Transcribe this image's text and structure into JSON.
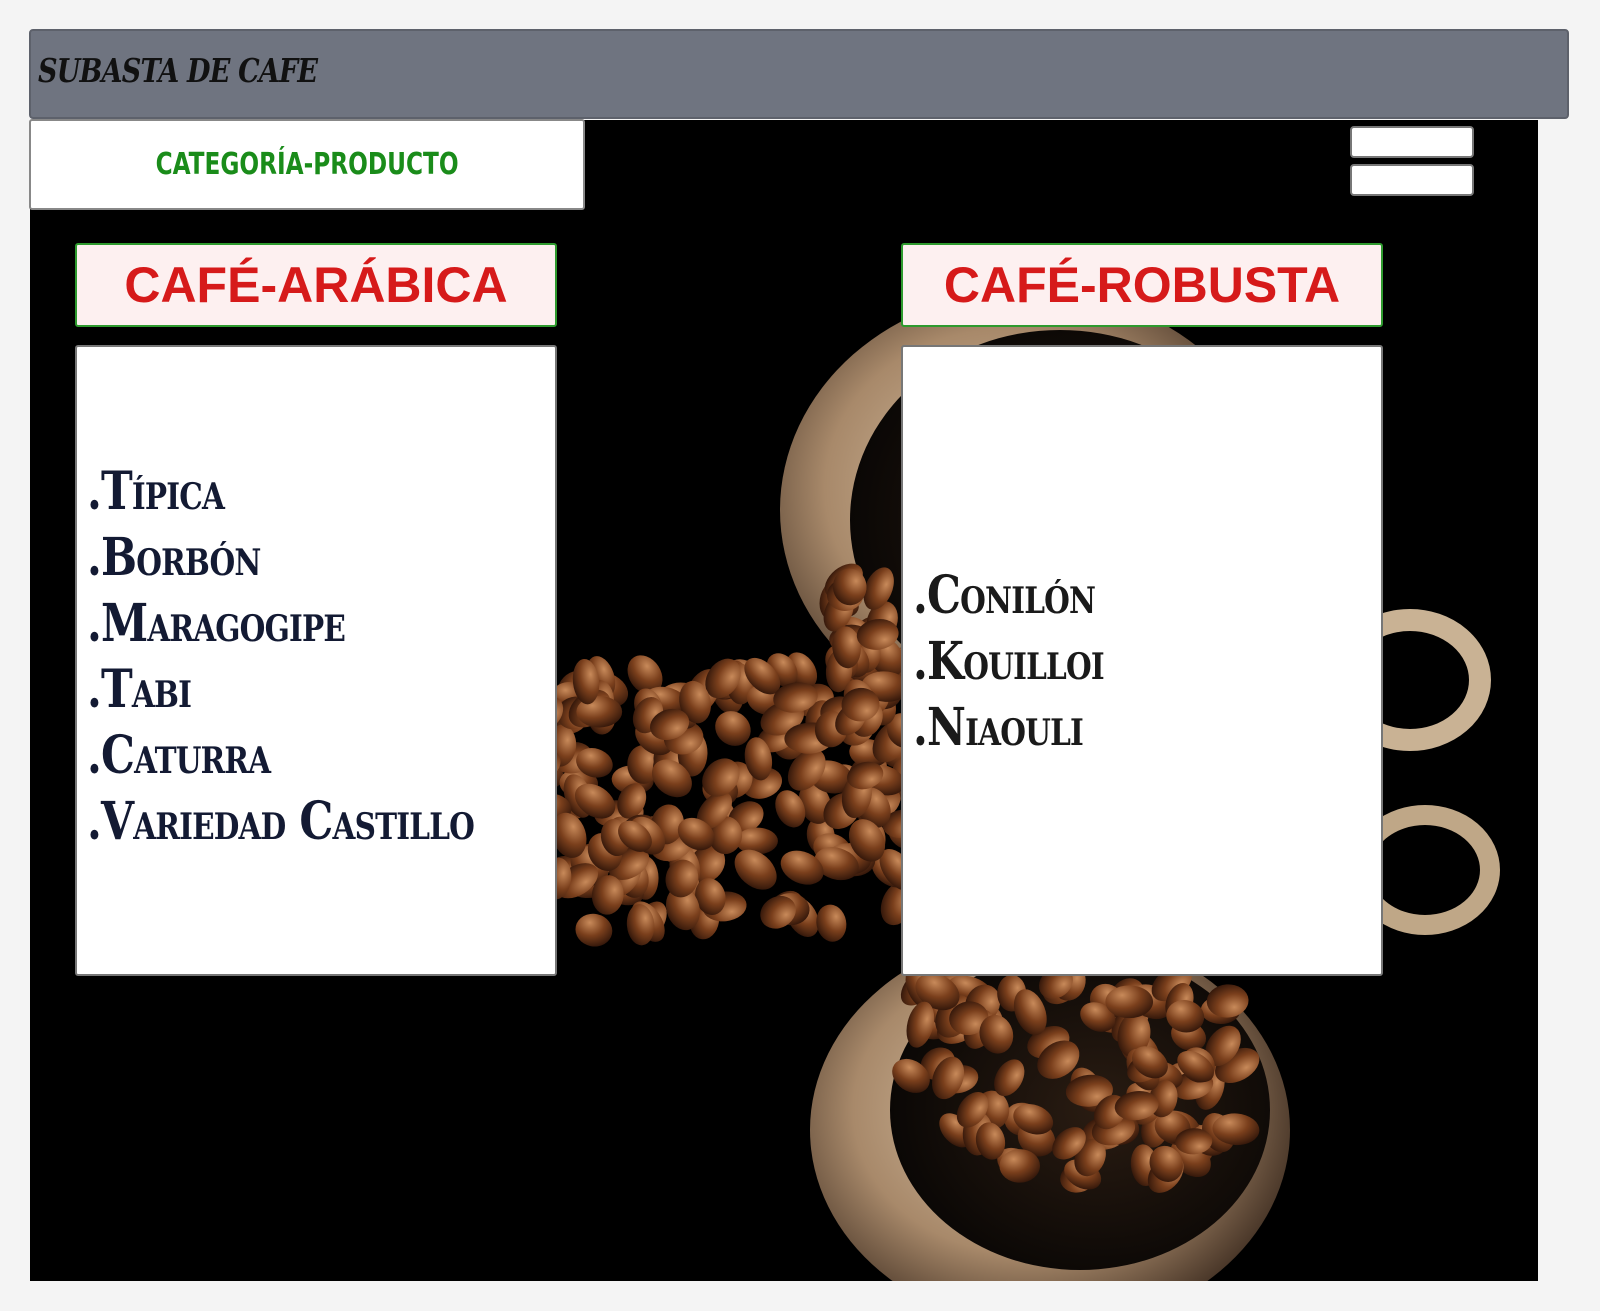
{
  "header": {
    "title": "SUBASTA DE CAFE"
  },
  "nav": {
    "category_button": "CATEGORÍA-PRODUCTO",
    "menu_icon": "hamburger-menu-icon"
  },
  "panels": [
    {
      "title": "CAFÉ-ARÁBICA",
      "items": [
        ".Típica",
        ".Borbón",
        ".Maragogipe",
        ".Tabi",
        ".Caturra",
        ".Variedad Castillo"
      ]
    },
    {
      "title": "CAFÉ-ROBUSTA",
      "items": [
        ".Conilón",
        ".Kouilloi",
        ".Niaouli"
      ]
    }
  ],
  "colors": {
    "header_bg": "#6f7480",
    "category_text": "#1a8c1a",
    "panel_title": "#d61a1a",
    "panel_title_border": "#2e9a2e",
    "list_text": "#131a33"
  }
}
